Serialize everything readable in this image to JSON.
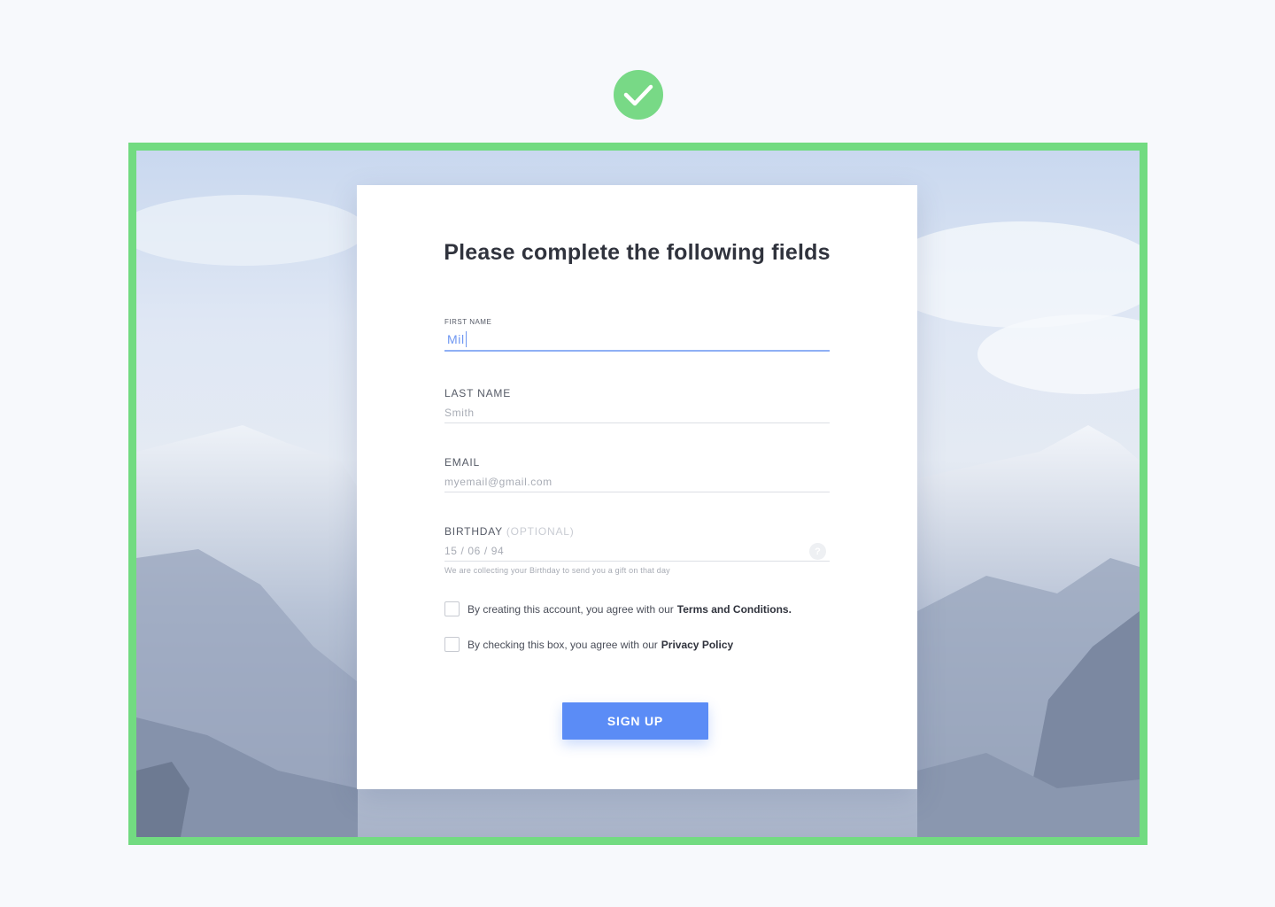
{
  "status": {
    "icon": "check-icon",
    "color": "#78d986"
  },
  "frame": {
    "border_color": "#72db81"
  },
  "form": {
    "title": "Please complete the following fields",
    "first_name": {
      "label": "FIRST NAME",
      "value": "Mil"
    },
    "last_name": {
      "label": "LAST NAME",
      "placeholder": "Smith"
    },
    "email": {
      "label": "EMAIL",
      "placeholder": "myemail@gmail.com"
    },
    "birthday": {
      "label": "BIRTHDAY",
      "optional": "(OPTIONAL)",
      "placeholder": "15 / 06 / 94",
      "help_icon": "question-icon",
      "help_glyph": "?",
      "hint": "We are collecting your Birthday to send you a gift on that day"
    },
    "terms": {
      "text": "By creating this account, you agree with our",
      "link": "Terms and Conditions."
    },
    "privacy": {
      "text": "By checking this box, you agree with our",
      "link": "Privacy Policy"
    },
    "submit_label": "SIGN UP",
    "accent_color": "#5b8cf6"
  }
}
